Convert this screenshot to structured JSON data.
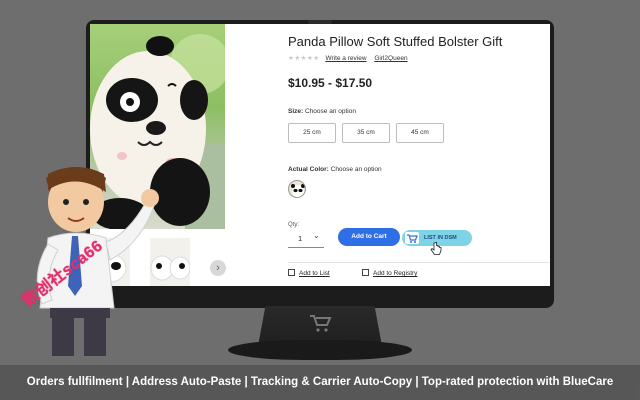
{
  "product": {
    "title": "Panda Pillow Soft Stuffed Bolster Gift",
    "rating_stars": "★★★★★",
    "write_review_label": "Write a review",
    "seller": "Girl2Queen",
    "price": "$10.95 - $17.50"
  },
  "size": {
    "label": "Size:",
    "prompt": "Choose an option",
    "options": [
      "25 cm",
      "35 cm",
      "45 cm"
    ]
  },
  "color": {
    "label": "Actual Color:",
    "prompt": "Choose an option"
  },
  "quantity": {
    "label": "Qty:",
    "value": "1",
    "chevron": "⌄"
  },
  "actions": {
    "add_to_cart": "Add to Cart",
    "list_in_dsm": "LIST IN DSM",
    "add_to_list": "Add to List",
    "add_to_registry": "Add to Registry"
  },
  "gallery": {
    "next_arrow": "›"
  },
  "watermark": "数创社sca66",
  "footer": {
    "features": "Orders fullfilment | Address Auto-Paste | Tracking & Carrier Auto-Copy | Top-rated protection with BlueCare"
  },
  "colors": {
    "accent_blue": "#2e6fe6",
    "dsm_cyan": "#7fd3e6",
    "background": "#6e6e6e",
    "watermark_pink": "#e0306d"
  },
  "icons": [
    "cart-icon",
    "chevron-down-icon",
    "chevron-right-icon",
    "hand-cursor-icon",
    "list-icon",
    "gift-icon",
    "monitor-logo-icon"
  ]
}
